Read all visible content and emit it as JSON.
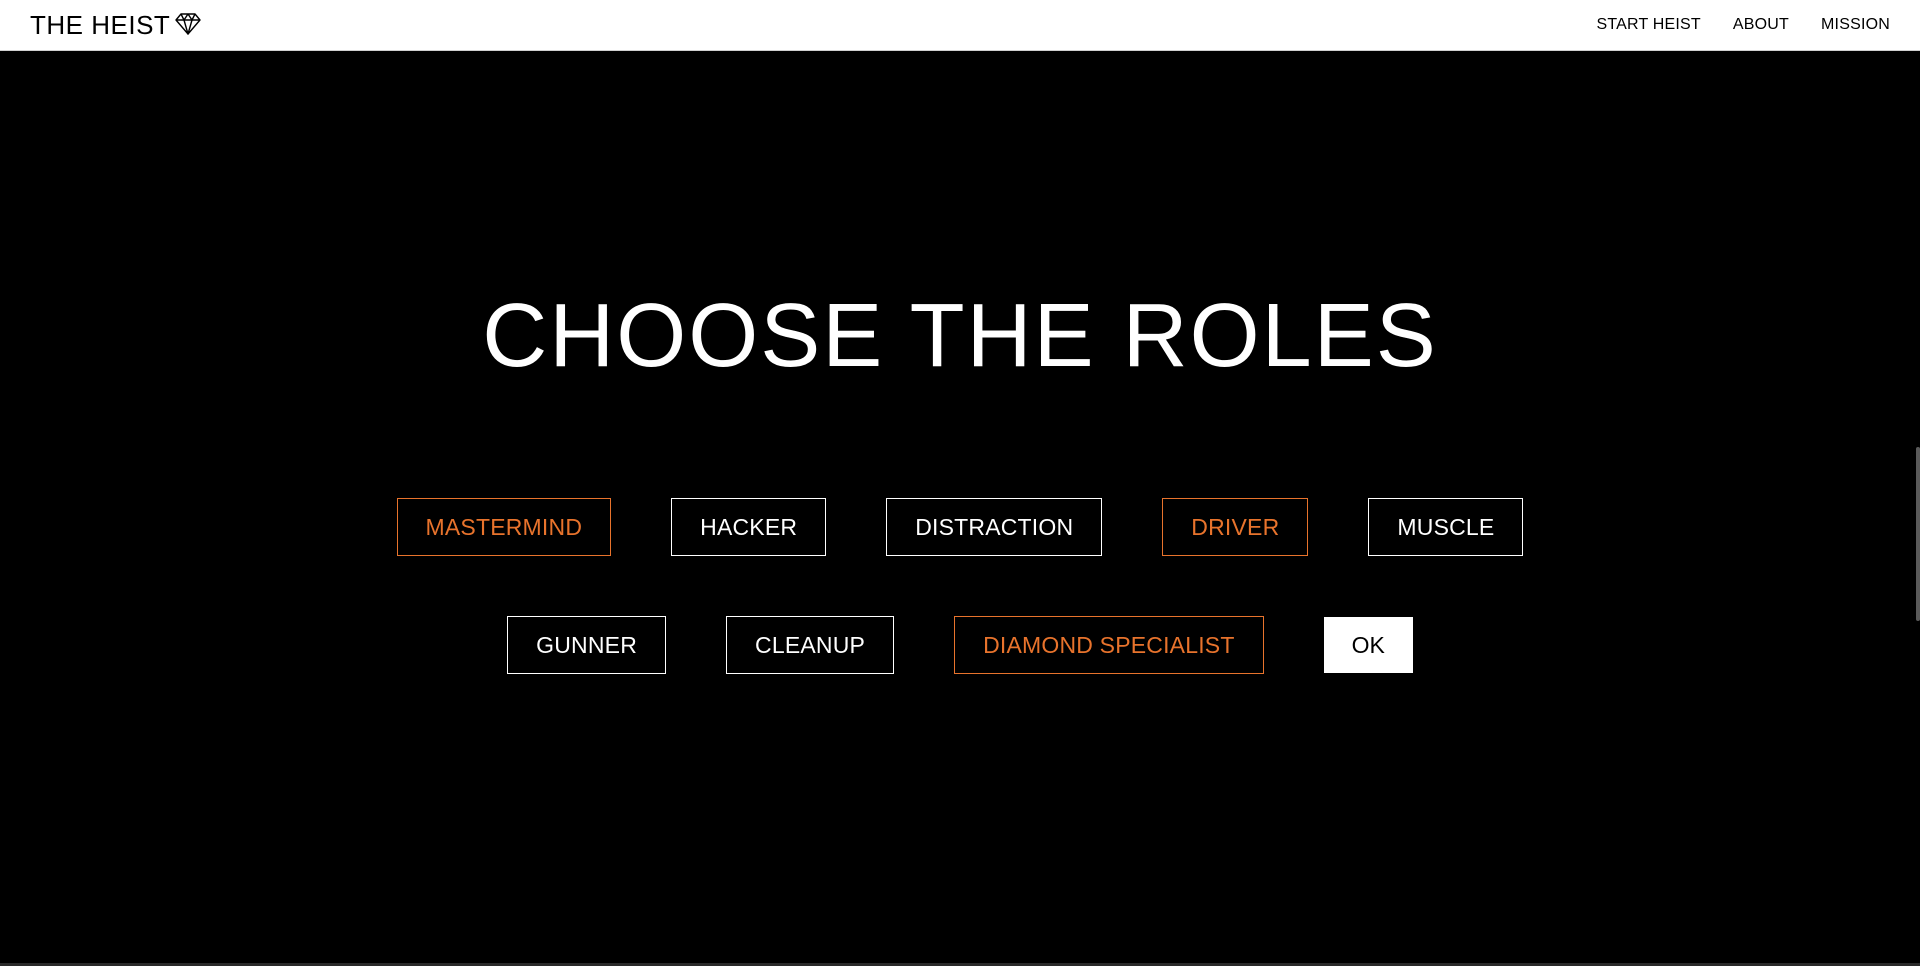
{
  "header": {
    "brand": "THE HEIST",
    "brand_icon": "diamond-icon",
    "nav": [
      {
        "label": "START HEIST"
      },
      {
        "label": "ABOUT"
      },
      {
        "label": "MISSION"
      }
    ]
  },
  "main": {
    "title": "CHOOSE THE ROLES",
    "roles_row_1": [
      {
        "label": "MASTERMIND",
        "selected": true
      },
      {
        "label": "HACKER",
        "selected": false
      },
      {
        "label": "DISTRACTION",
        "selected": false
      },
      {
        "label": "DRIVER",
        "selected": true
      },
      {
        "label": "MUSCLE",
        "selected": false
      }
    ],
    "roles_row_2": [
      {
        "label": "GUNNER",
        "selected": false
      },
      {
        "label": "CLEANUP",
        "selected": false
      },
      {
        "label": "DIAMOND SPECIALIST",
        "selected": true
      }
    ],
    "ok_label": "OK"
  },
  "colors": {
    "accent": "#e8732c",
    "background": "#000000",
    "header_bg": "#ffffff"
  }
}
